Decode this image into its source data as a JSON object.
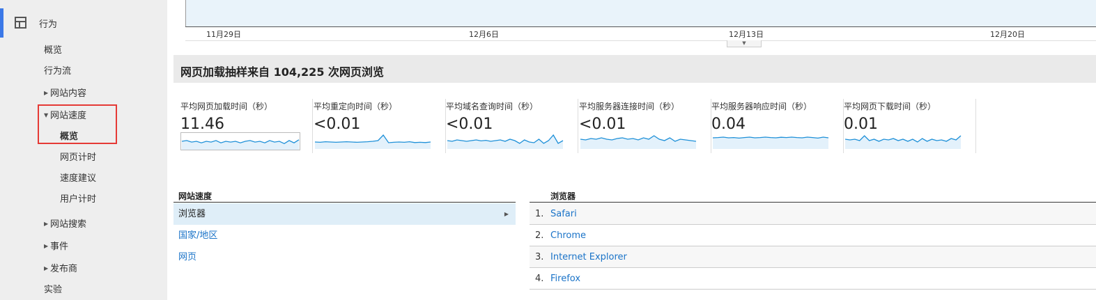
{
  "sidebar": {
    "section_title": "行为",
    "items": {
      "overview": "概览",
      "behavior_flow": "行为流",
      "site_content": "网站内容",
      "site_speed": "网站速度",
      "speed_overview": "概览",
      "page_timings": "网页计时",
      "speed_suggestions": "速度建议",
      "user_timings": "用户计时",
      "site_search": "网站搜索",
      "events": "事件",
      "publisher": "发布商",
      "experiments": "实验"
    }
  },
  "timeline": {
    "ticks": [
      "11月29日",
      "12月6日",
      "12月13日",
      "12月20日"
    ]
  },
  "header": {
    "title": "网页加载抽样来自 104,225 次网页浏览"
  },
  "metrics": [
    {
      "label": "平均网页加载时间（秒）",
      "value": "11.46",
      "spark": [
        0.5,
        0.55,
        0.45,
        0.5,
        0.4,
        0.5,
        0.45,
        0.55,
        0.4,
        0.5,
        0.45,
        0.5,
        0.4,
        0.5,
        0.55,
        0.45,
        0.5,
        0.4,
        0.55,
        0.45,
        0.5,
        0.35,
        0.55,
        0.4,
        0.6
      ]
    },
    {
      "label": "平均重定向时间（秒）",
      "value": "<0.01",
      "spark": [
        0.4,
        0.38,
        0.42,
        0.4,
        0.38,
        0.4,
        0.42,
        0.4,
        0.38,
        0.4,
        0.42,
        0.45,
        0.5,
        0.9,
        0.35,
        0.38,
        0.4,
        0.38,
        0.42,
        0.36,
        0.38,
        0.36,
        0.4
      ]
    },
    {
      "label": "平均域名查询时间（秒）",
      "value": "<0.01",
      "spark": [
        0.5,
        0.45,
        0.55,
        0.5,
        0.45,
        0.5,
        0.55,
        0.48,
        0.52,
        0.45,
        0.5,
        0.55,
        0.45,
        0.6,
        0.5,
        0.3,
        0.55,
        0.4,
        0.35,
        0.6,
        0.3,
        0.5,
        0.9,
        0.3,
        0.5
      ]
    },
    {
      "label": "平均服务器连接时间（秒）",
      "value": "<0.01",
      "spark": [
        0.6,
        0.55,
        0.65,
        0.6,
        0.7,
        0.6,
        0.55,
        0.65,
        0.7,
        0.6,
        0.65,
        0.55,
        0.7,
        0.6,
        0.85,
        0.6,
        0.5,
        0.7,
        0.45,
        0.6,
        0.55,
        0.5,
        0.45
      ]
    },
    {
      "label": "平均服务器响应时间（秒）",
      "value": "0.04",
      "spark": [
        0.7,
        0.72,
        0.75,
        0.7,
        0.72,
        0.68,
        0.72,
        0.75,
        0.7,
        0.72,
        0.75,
        0.72,
        0.7,
        0.74,
        0.72,
        0.75,
        0.72,
        0.7,
        0.75,
        0.72,
        0.68,
        0.75,
        0.7
      ]
    },
    {
      "label": "平均网页下载时间（秒）",
      "value": "0.01",
      "spark": [
        0.6,
        0.55,
        0.6,
        0.5,
        0.85,
        0.5,
        0.6,
        0.45,
        0.6,
        0.55,
        0.65,
        0.5,
        0.6,
        0.45,
        0.6,
        0.4,
        0.65,
        0.45,
        0.6,
        0.5,
        0.55,
        0.45,
        0.65,
        0.55,
        0.85
      ]
    }
  ],
  "dimension_panel": {
    "header": "网站速度",
    "rows": [
      "浏览器",
      "国家/地区",
      "网页"
    ]
  },
  "browser_panel": {
    "header": "浏览器",
    "rows": [
      {
        "num": "1.",
        "name": "Safari"
      },
      {
        "num": "2.",
        "name": "Chrome"
      },
      {
        "num": "3.",
        "name": "Internet Explorer"
      },
      {
        "num": "4.",
        "name": "Firefox"
      }
    ]
  },
  "colors": {
    "link": "#1a73c8",
    "spark_line": "#1e90d8",
    "spark_fill": "#e3f1fb",
    "highlight_box": "#e53935",
    "active_bar": "#3b78e7"
  }
}
